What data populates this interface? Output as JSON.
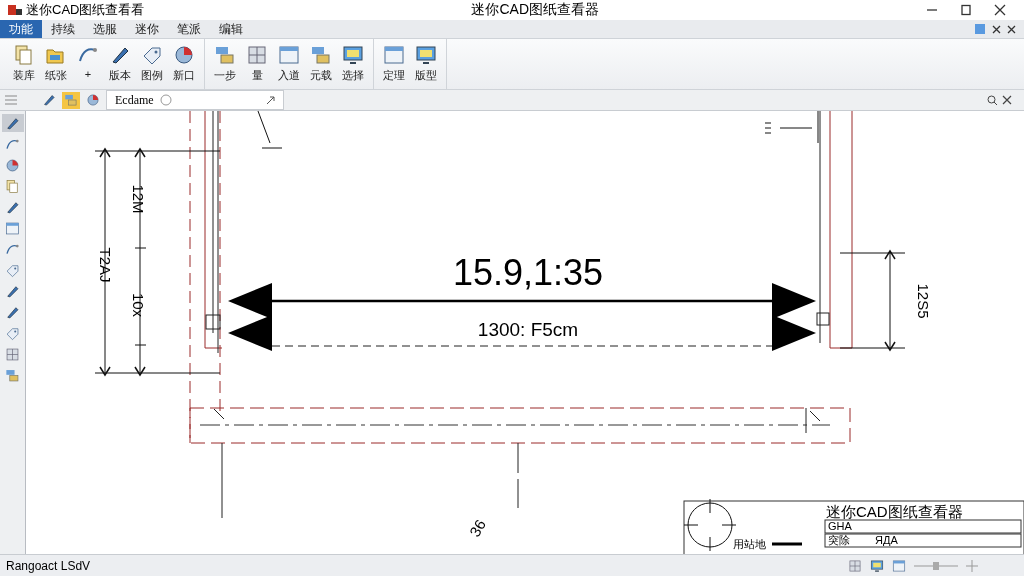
{
  "window": {
    "app_name": "迷你CAD图纸查看看",
    "title": "迷你CAD图纸查看器"
  },
  "menu": [
    {
      "label": "功能",
      "selected": true
    },
    {
      "label": "持续",
      "selected": false
    },
    {
      "label": "选服",
      "selected": false
    },
    {
      "label": "迷你",
      "selected": false
    },
    {
      "label": "笔派",
      "selected": false
    },
    {
      "label": "编辑",
      "selected": false
    }
  ],
  "ribbon": {
    "groups": [
      {
        "buttons": [
          {
            "label": "装库"
          },
          {
            "label": "纸张"
          },
          {
            "label": "+"
          },
          {
            "label": "版本"
          },
          {
            "label": "图例"
          },
          {
            "label": "新口"
          }
        ]
      },
      {
        "buttons": [
          {
            "label": "一步"
          },
          {
            "label": "量"
          },
          {
            "label": "入道"
          },
          {
            "label": "元载"
          },
          {
            "label": "选择"
          }
        ]
      },
      {
        "buttons": [
          {
            "label": "定理"
          },
          {
            "label": "版型"
          }
        ]
      }
    ]
  },
  "toolbar": {
    "tools": [
      {
        "selected": false
      },
      {
        "selected": true
      },
      {
        "selected": false
      }
    ],
    "document_tab": "Ecdame"
  },
  "left_tools": [
    {
      "selected": true
    },
    {
      "selected": false
    },
    {
      "selected": false
    },
    {
      "selected": false
    },
    {
      "selected": false
    },
    {
      "selected": false
    },
    {
      "selected": false
    },
    {
      "selected": false
    },
    {
      "selected": false
    },
    {
      "selected": false
    },
    {
      "selected": false
    },
    {
      "selected": false
    },
    {
      "selected": false
    }
  ],
  "drawing": {
    "main_dimension": "15.9,1:35",
    "sub_dimension": "1300: F5cm",
    "left_dimensions": [
      "T2AJ",
      "12M",
      "10x"
    ],
    "right_dimension": "12S5",
    "note": "36"
  },
  "title_block": {
    "title": "迷你CAD图纸查看器",
    "scale_label": "用站地",
    "rows": [
      {
        "label": "GHA"
      },
      {
        "label": "突除",
        "value": "ЯДА"
      }
    ]
  },
  "status_bar": {
    "text": "Rangoact LSdV"
  }
}
